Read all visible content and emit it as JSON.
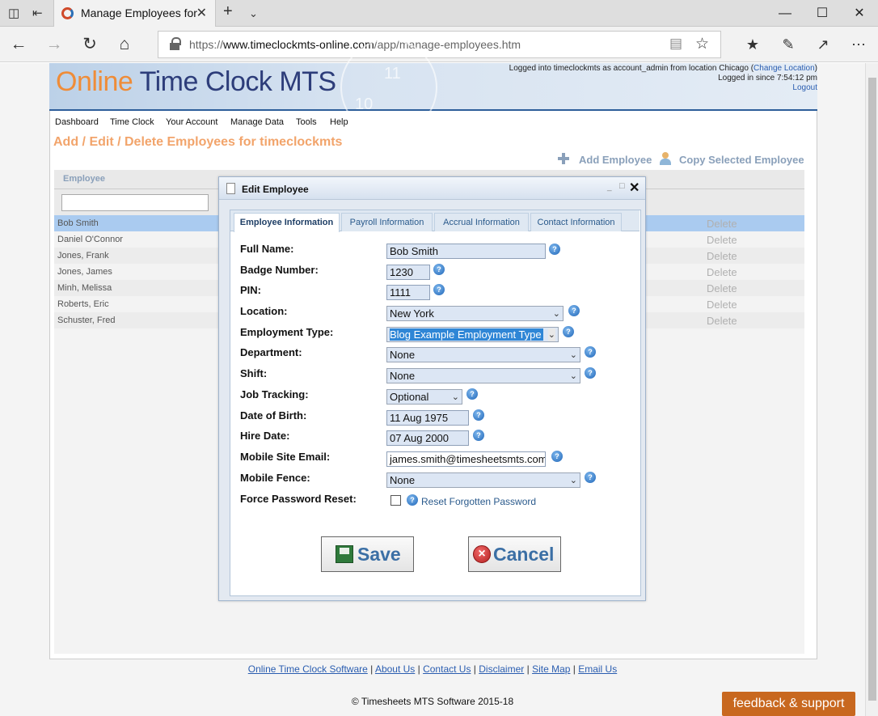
{
  "browser": {
    "tab_title": "Manage Employees for",
    "url_prefix": "https://",
    "url_host": "www.timeclockmts-online.com",
    "url_path": "/app/manage-employees.htm"
  },
  "banner": {
    "logo_online": "Online",
    "logo_timeclock": "Time Clock",
    "logo_mts": "MTS",
    "clock_numbers": [
      "11",
      "10"
    ],
    "login_line_prefix": "Logged into timeclockmts as account_admin from location Chicago (",
    "change_location": "Change Location",
    "login_line_suffix": ")",
    "logged_in_since": "Logged in since 7:54:12 pm",
    "logout": "Logout"
  },
  "menu": [
    "Dashboard",
    "Time Clock",
    "Your Account",
    "Manage Data",
    "Tools",
    "Help"
  ],
  "page_title": "Add / Edit / Delete Employees for timeclockmts",
  "actions": {
    "add_employee": "Add Employee",
    "copy_selected": "Copy Selected Employee"
  },
  "grid": {
    "column_header": "Employee",
    "filter_value": "",
    "delete_label": "Delete",
    "rows": [
      "Bob Smith",
      "Daniel O'Connor",
      "Jones, Frank",
      "Jones, James",
      "Minh, Melissa",
      "Roberts, Eric",
      "Schuster, Fred"
    ]
  },
  "dialog": {
    "title": "Edit Employee",
    "tabs": [
      "Employee Information",
      "Payroll Information",
      "Accrual Information",
      "Contact Information"
    ],
    "fields": {
      "full_name_label": "Full Name:",
      "full_name": "Bob Smith",
      "badge_label": "Badge Number:",
      "badge": "1230",
      "pin_label": "PIN:",
      "pin": "1111",
      "location_label": "Location:",
      "location": "New York",
      "employment_type_label": "Employment Type:",
      "employment_type": "Blog Example Employment Type",
      "department_label": "Department:",
      "department": "None",
      "shift_label": "Shift:",
      "shift": "None",
      "job_tracking_label": "Job Tracking:",
      "job_tracking": "Optional",
      "dob_label": "Date of Birth:",
      "dob": "11 Aug 1975",
      "hire_label": "Hire Date:",
      "hire": "07 Aug 2000",
      "email_label": "Mobile Site Email:",
      "email": "james.smith@timesheetsmts.com",
      "fence_label": "Mobile Fence:",
      "fence": "None",
      "force_reset_label": "Force Password Reset:",
      "force_reset_checked": false,
      "reset_link": "Reset Forgotten Password"
    },
    "save_label": "Save",
    "cancel_label": "Cancel"
  },
  "footer": {
    "links": [
      "Online Time Clock Software",
      "About Us",
      "Contact Us",
      "Disclaimer",
      "Site Map",
      "Email Us"
    ],
    "copyright": "© Timesheets MTS Software 2015-18",
    "feedback": "feedback & support"
  },
  "colors": {
    "accent": "#2d5e9a",
    "heading_orange": "#f2a46b",
    "selected_row": "#aacbf0",
    "feedback_bg": "#c8681f"
  }
}
